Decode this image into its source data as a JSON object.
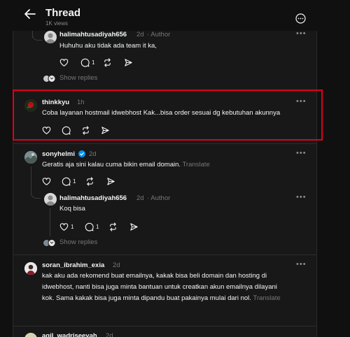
{
  "header": {
    "title": "Thread",
    "views": "1K views"
  },
  "posts": {
    "p1": {
      "username": "halimahtusadiyah656",
      "time": "2d",
      "role": "· Author",
      "text": "Huhuhu aku tidak ada team it ka,",
      "reply_count": "1",
      "show_replies": "Show replies"
    },
    "p2": {
      "username": "thinkkyu",
      "time": "1h",
      "text": "Coba layanan hostmail idwebhost Kak...bisa order sesuai dg kebutuhan akunnya"
    },
    "p3": {
      "username": "sonyhelmi",
      "time": "2d",
      "text": "Geratis aja sini kalau cuma bikin email domain.",
      "translate": "Translate",
      "reply_count": "1"
    },
    "p4": {
      "username": "halimahtusadiyah656",
      "time": "2d",
      "role": "· Author",
      "text": "Koq bisa",
      "like_count": "1",
      "reply_count": "1",
      "show_replies": "Show replies"
    },
    "p5": {
      "username": "soran_ibrahim_exia",
      "time": "2d",
      "line1": "kak aku ada rekomend buat emailnya, kakak bisa beli domain dan hosting di",
      "line2": "idwebhost, nanti bisa juga minta bantuan untuk creatkan akun emailnya dilayani",
      "line3": "kok. Sama kakak bisa juga minta dipandu buat pakainya mulai dari nol.",
      "translate": "Translate"
    },
    "p6": {
      "username": "agil_wadriseeyah",
      "time": "2d"
    }
  },
  "colors": {
    "background": "#101010",
    "panel": "#181818",
    "highlight": "#e0001b",
    "verified": "#0095f6"
  }
}
